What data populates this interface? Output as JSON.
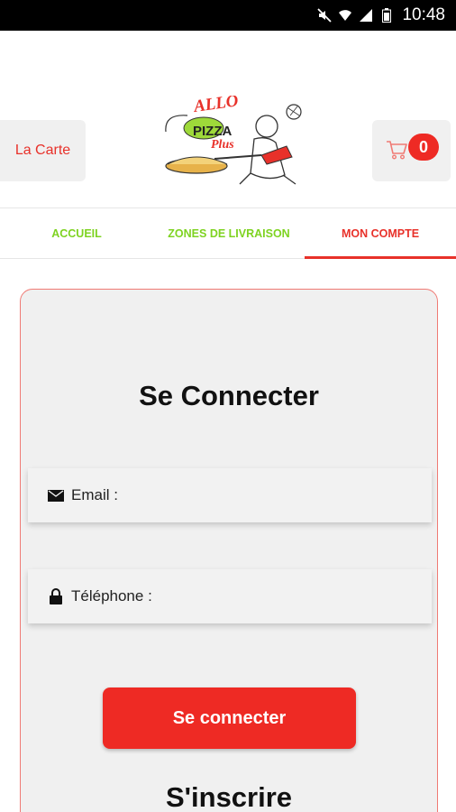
{
  "status_bar": {
    "time": "10:48"
  },
  "header": {
    "la_carte_label": "La Carte",
    "logo": {
      "line1": "ALLO",
      "line2": "PIZZA",
      "line3": "Plus"
    },
    "cart": {
      "count": "0"
    }
  },
  "tabs": [
    {
      "label": "ACCUEIL"
    },
    {
      "label": "ZONES DE LIVRAISON"
    },
    {
      "label": "MON COMPTE"
    }
  ],
  "login": {
    "title": "Se Connecter",
    "email_label": "Email :",
    "phone_label": "Téléphone :",
    "connect_button": "Se connecter",
    "register_label": "S'inscrire"
  },
  "colors": {
    "accent": "#ee2a24",
    "green": "#7ed321"
  }
}
